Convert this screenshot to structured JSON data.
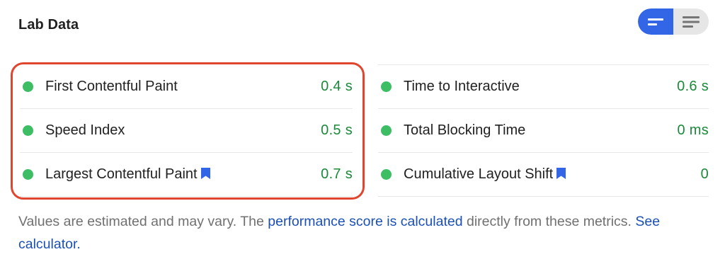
{
  "header": {
    "title": "Lab Data"
  },
  "view_toggle": {
    "active_icon": "summary-view-icon",
    "inactive_icon": "list-view-icon",
    "active_color": "#3366e6"
  },
  "metrics_left": [
    {
      "label": "First Contentful Paint",
      "value": "0.4 s",
      "status": "pass",
      "bookmark": false
    },
    {
      "label": "Speed Index",
      "value": "0.5 s",
      "status": "pass",
      "bookmark": false
    },
    {
      "label": "Largest Contentful Paint",
      "value": "0.7 s",
      "status": "pass",
      "bookmark": true
    }
  ],
  "metrics_right": [
    {
      "label": "Time to Interactive",
      "value": "0.6 s",
      "status": "pass",
      "bookmark": false
    },
    {
      "label": "Total Blocking Time",
      "value": "0 ms",
      "status": "pass",
      "bookmark": false
    },
    {
      "label": "Cumulative Layout Shift",
      "value": "0",
      "status": "pass",
      "bookmark": true
    }
  ],
  "footer": {
    "text_1": "Values are estimated and may vary. The ",
    "link_1": "performance score is calculated",
    "text_2": " directly from these metrics. ",
    "link_2": "See calculator."
  },
  "colors": {
    "pass": "#3dbe64",
    "value_text": "#1a8a3a",
    "highlight": "#e0452d",
    "link": "#1a4fb4",
    "bookmark": "#3366e6"
  }
}
